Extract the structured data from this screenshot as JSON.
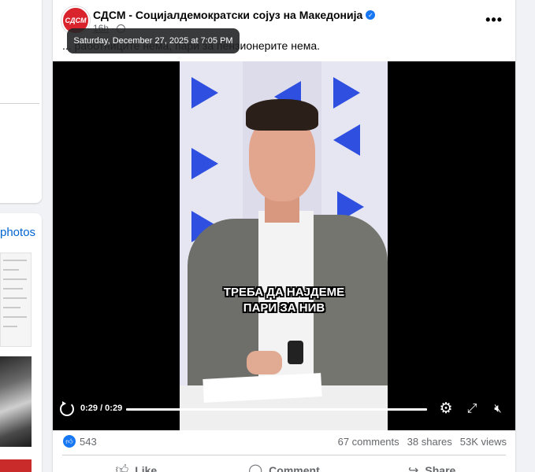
{
  "left_column": {
    "photos_link": "photos"
  },
  "post": {
    "author": "СДСМ - Социјалдемократски сојуз на Македонија",
    "avatar_text": "СДСМ",
    "time": "16h",
    "tooltip": "Saturday, December 27, 2025 at 7:05 PM",
    "text": "... работниците нема, пари за пензионерите нема.",
    "more_label": "•••"
  },
  "video": {
    "caption_line1": "ТРЕБА ДА НАЈДЕМЕ",
    "caption_line2": "ПАРИ ЗА НИВ",
    "time_readout": "0:29 / 0:29",
    "progress": 1.0
  },
  "stats": {
    "reactions": "543",
    "comments": "67 comments",
    "shares": "38 shares",
    "views": "53K views"
  },
  "actions": {
    "like": "Like",
    "comment": "Comment",
    "share": "Share"
  },
  "colors": {
    "brand_blue": "#1877f2",
    "party_red": "#d9232d",
    "link_blue": "#0064d1"
  }
}
